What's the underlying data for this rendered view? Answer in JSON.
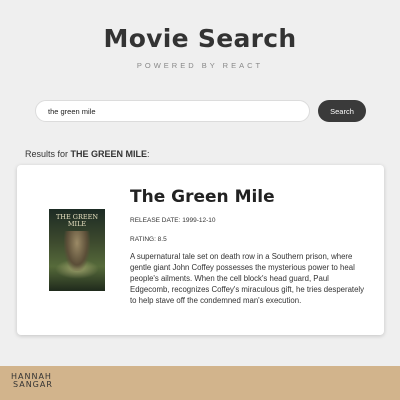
{
  "header": {
    "title": "Movie Search",
    "subtitle": "POWERED BY REACT"
  },
  "search": {
    "value": "the green mile",
    "button_label": "Search"
  },
  "results": {
    "prefix": "Results for",
    "query": "THE GREEN MILE",
    "suffix": ":"
  },
  "movie": {
    "title": "The Green Mile",
    "poster_text": "THE GREEN MILE",
    "release_date_label": "RELEASE DATE: 1999-12-10",
    "rating_label": "RATING: 8.5",
    "description": "A supernatural tale set on death row in a Southern prison, where gentle giant John Coffey possesses the mysterious power to heal people's ailments. When the cell block's head guard, Paul Edgecomb, recognizes Coffey's miraculous gift, he tries desperately to help stave off the condemned man's execution."
  },
  "footer": {
    "logo_line1": "HANNAH",
    "logo_line2": "SANGAR",
    "background": "#d2b48c"
  }
}
